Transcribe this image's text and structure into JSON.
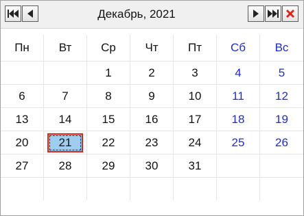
{
  "calendar": {
    "title": "Декабрь, 2021",
    "nav": {
      "prev_year": "prev-year",
      "prev_month": "prev-month",
      "next_month": "next-month",
      "next_year": "next-year",
      "close": "close"
    },
    "weekdays": [
      "Пн",
      "Вт",
      "Ср",
      "Чт",
      "Пт",
      "Сб",
      "Вс"
    ],
    "weeks": [
      [
        "",
        "",
        "1",
        "2",
        "3",
        "4",
        "5"
      ],
      [
        "6",
        "7",
        "8",
        "9",
        "10",
        "11",
        "12"
      ],
      [
        "13",
        "14",
        "15",
        "16",
        "17",
        "18",
        "19"
      ],
      [
        "20",
        "21",
        "22",
        "23",
        "24",
        "25",
        "26"
      ],
      [
        "27",
        "28",
        "29",
        "30",
        "31",
        "",
        ""
      ],
      [
        "",
        "",
        "",
        "",
        "",
        "",
        ""
      ]
    ],
    "selected_day": "21",
    "colors": {
      "weekend": "#1c2bd6",
      "selection_fill": "#9fcdf0",
      "selection_border": "#e2231a",
      "close": "#e2231a"
    }
  }
}
